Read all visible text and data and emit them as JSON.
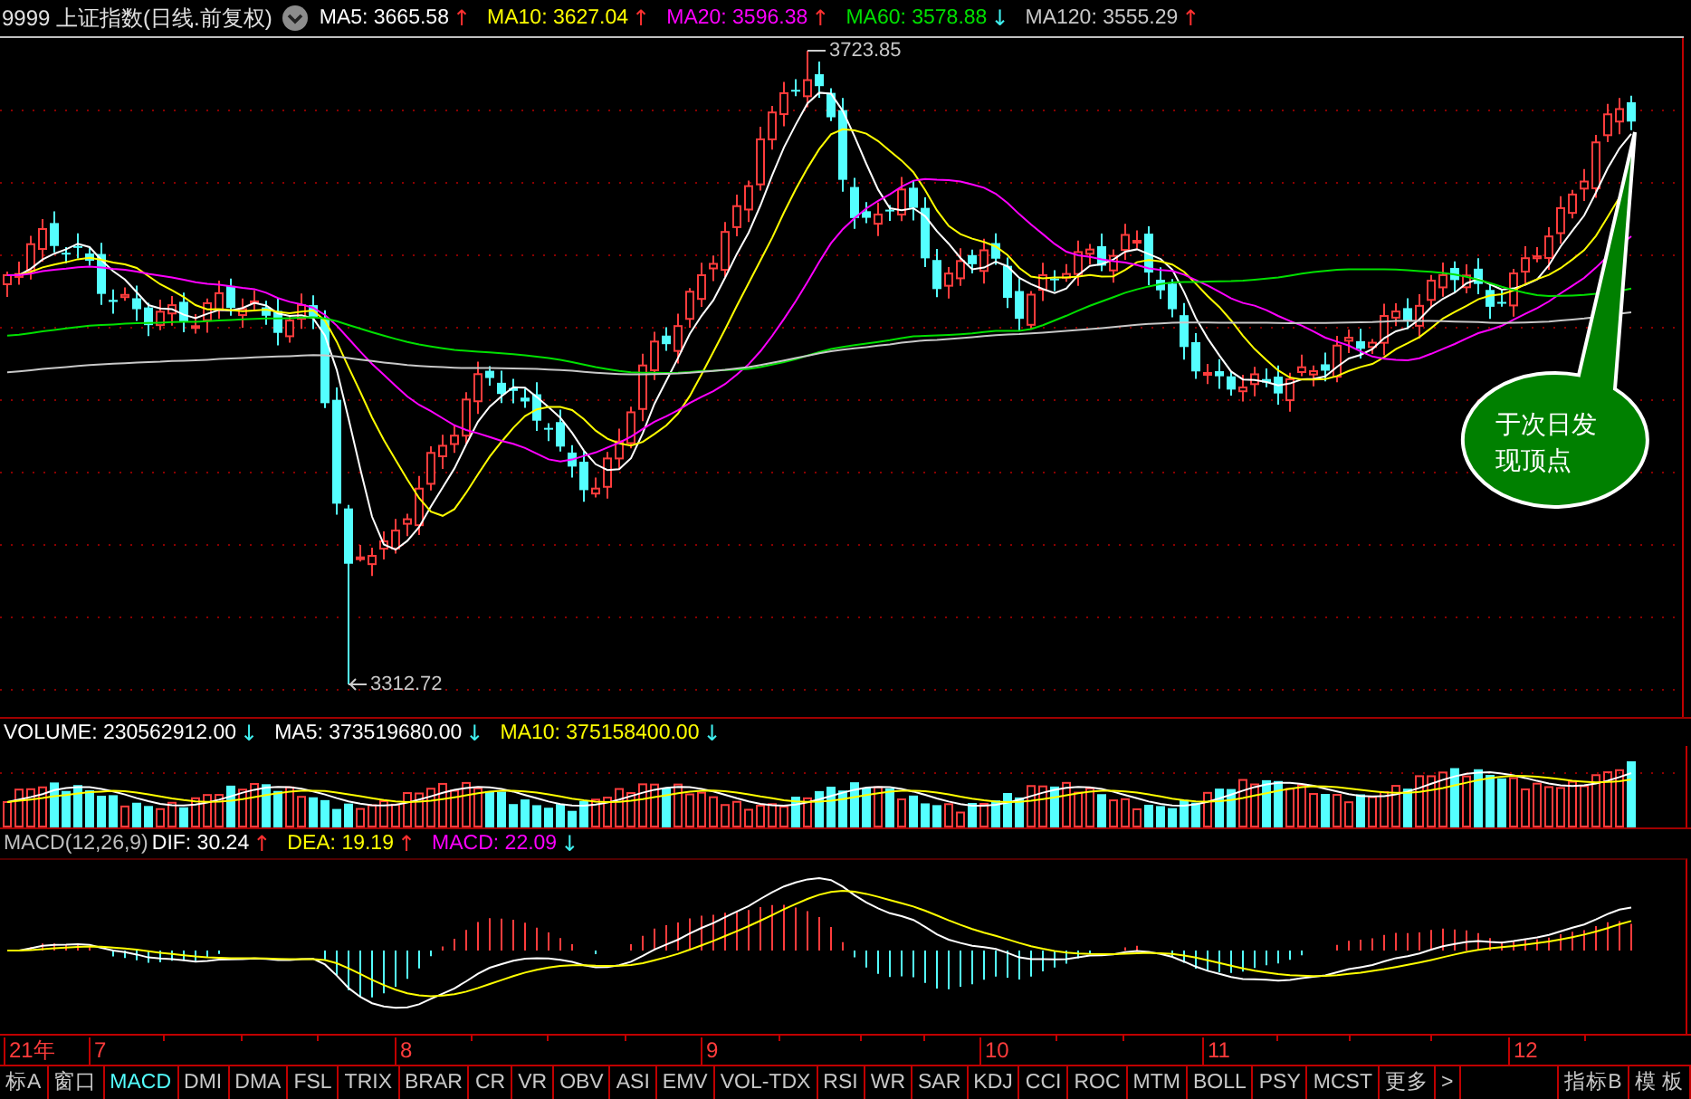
{
  "title": "9999 上证指数(日线.前复权)",
  "ma_legend": [
    {
      "label": "MA5: 3665.58",
      "color": "#ffffff",
      "arrow": "↑",
      "rising": true
    },
    {
      "label": "MA10: 3627.04",
      "color": "#ffff00",
      "arrow": "↑",
      "rising": true
    },
    {
      "label": "MA20: 3596.38",
      "color": "#ff00ff",
      "arrow": "↑",
      "rising": true
    },
    {
      "label": "MA60: 3578.88",
      "color": "#00e000",
      "arrow": "↓",
      "rising": false
    },
    {
      "label": "MA120: 3555.29",
      "color": "#c8c8c8",
      "arrow": "↑",
      "rising": true
    }
  ],
  "price_markers": {
    "high": "3723.85",
    "low": "3312.72"
  },
  "callout": "于次日发现顶点",
  "volume_legend": [
    {
      "label": "VOLUME: 230562912.00",
      "color": "#ffffff",
      "arrow": "↓",
      "rising": false
    },
    {
      "label": "MA5: 373519680.00",
      "color": "#ffffff",
      "arrow": "↓",
      "rising": false
    },
    {
      "label": "MA10: 375158400.00",
      "color": "#ffff00",
      "arrow": "↓",
      "rising": false
    }
  ],
  "macd_legend": {
    "name": "MACD(12,26,9)",
    "items": [
      {
        "label": "DIF: 30.24",
        "color": "#ffffff",
        "arrow": "↑",
        "rising": true
      },
      {
        "label": "DEA: 19.19",
        "color": "#ffff00",
        "arrow": "↑",
        "rising": true
      },
      {
        "label": "MACD: 22.09",
        "color": "#ff00ff",
        "arrow": "↓",
        "rising": false
      }
    ]
  },
  "date_axis": [
    "21年",
    "7",
    "8",
    "9",
    "10",
    "11",
    "12"
  ],
  "indicator_tabs": [
    {
      "label": "标A",
      "selected": false
    },
    {
      "label": "窗口",
      "selected": false
    },
    {
      "label": "MACD",
      "selected": true
    },
    {
      "label": "DMI",
      "selected": false
    },
    {
      "label": "DMA",
      "selected": false
    },
    {
      "label": "FSL",
      "selected": false
    },
    {
      "label": "TRIX",
      "selected": false
    },
    {
      "label": "BRAR",
      "selected": false
    },
    {
      "label": "CR",
      "selected": false
    },
    {
      "label": "VR",
      "selected": false
    },
    {
      "label": "OBV",
      "selected": false
    },
    {
      "label": "ASI",
      "selected": false
    },
    {
      "label": "EMV",
      "selected": false
    },
    {
      "label": "VOL-TDX",
      "selected": false
    },
    {
      "label": "RSI",
      "selected": false
    },
    {
      "label": "WR",
      "selected": false
    },
    {
      "label": "SAR",
      "selected": false
    },
    {
      "label": "KDJ",
      "selected": false
    },
    {
      "label": "CCI",
      "selected": false
    },
    {
      "label": "ROC",
      "selected": false
    },
    {
      "label": "MTM",
      "selected": false
    },
    {
      "label": "BOLL",
      "selected": false
    },
    {
      "label": "PSY",
      "selected": false
    },
    {
      "label": "MCST",
      "selected": false
    },
    {
      "label": "更多",
      "selected": false
    },
    {
      "label": ">",
      "selected": false
    }
  ],
  "right_tabs": [
    "指标B",
    "模 板"
  ]
}
